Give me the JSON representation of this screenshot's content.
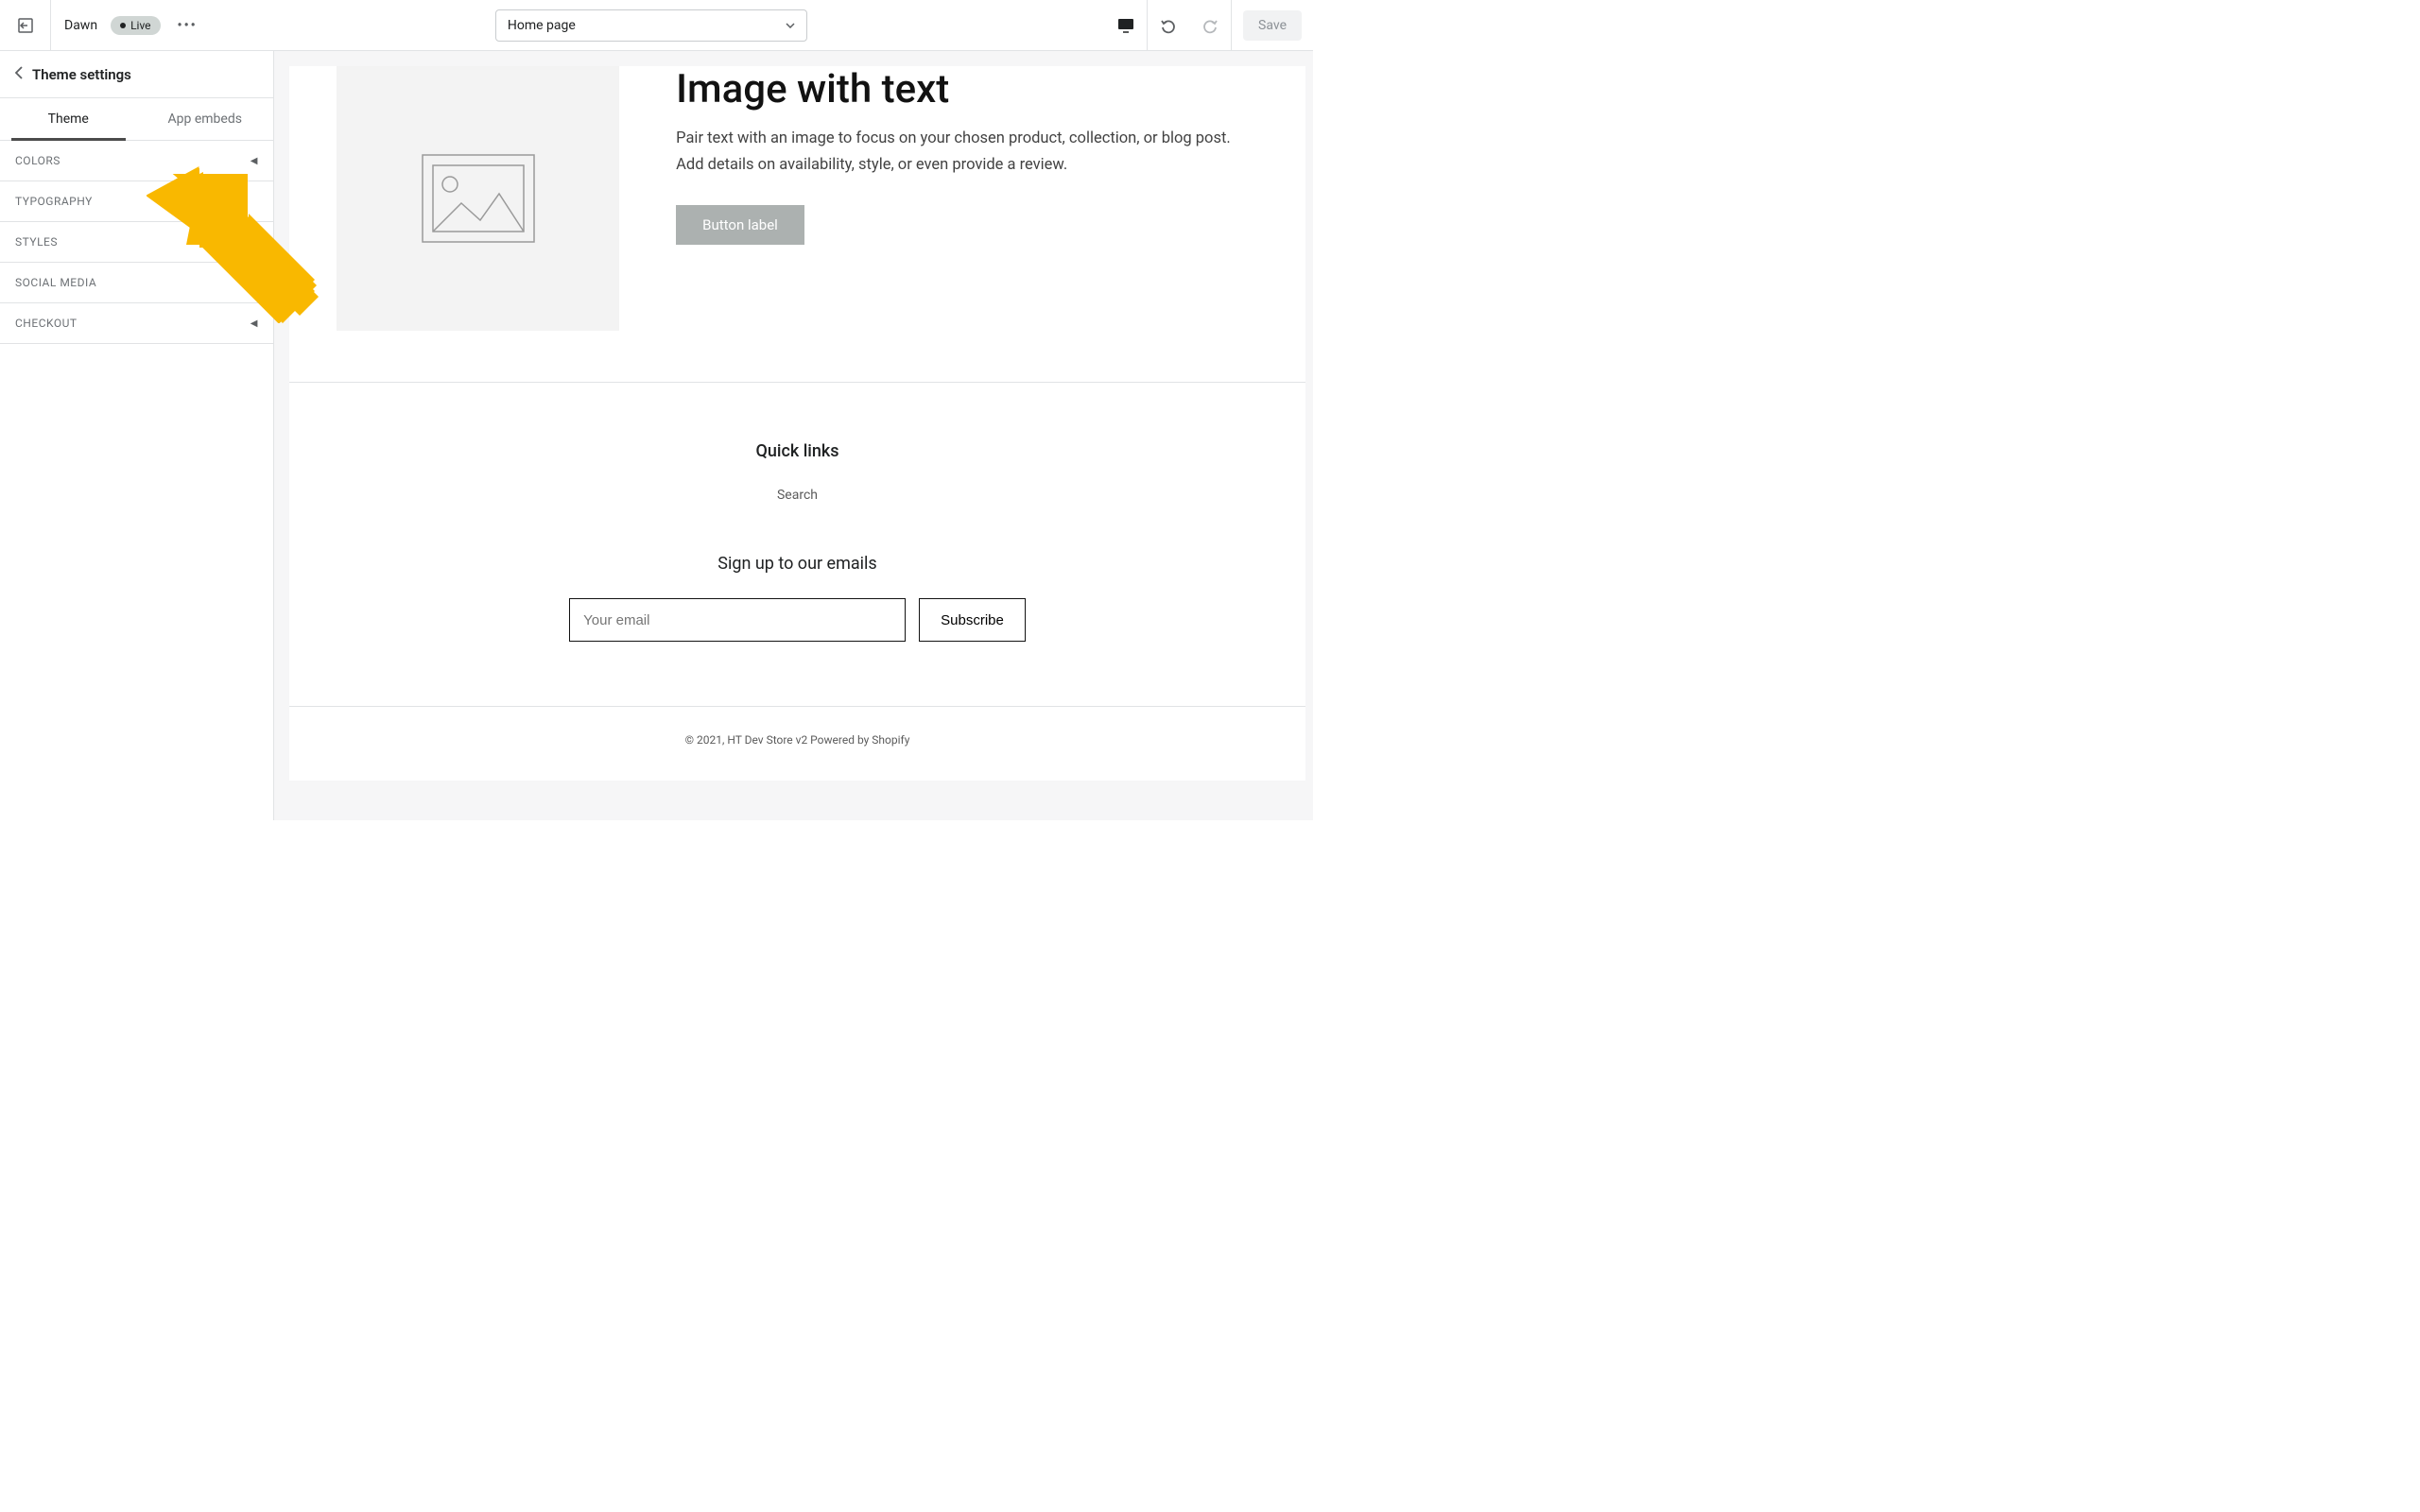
{
  "topbar": {
    "theme_name": "Dawn",
    "live_label": "Live",
    "page_select": "Home page",
    "save_label": "Save"
  },
  "sidebar": {
    "title": "Theme settings",
    "tabs": {
      "theme": "Theme",
      "app_embeds": "App embeds"
    },
    "items": [
      {
        "label": "COLORS"
      },
      {
        "label": "TYPOGRAPHY"
      },
      {
        "label": "STYLES"
      },
      {
        "label": "SOCIAL MEDIA"
      },
      {
        "label": "CHECKOUT"
      }
    ]
  },
  "preview": {
    "section_heading": "Image with text",
    "section_body": "Pair text with an image to focus on your chosen product, collection, or blog post. Add details on availability, style, or even provide a review.",
    "button_label": "Button label",
    "quick_links_title": "Quick links",
    "quick_links_item": "Search",
    "signup_title": "Sign up to our emails",
    "email_placeholder": "Your email",
    "subscribe_label": "Subscribe",
    "copyright": "© 2021, HT Dev Store v2 Powered by Shopify"
  }
}
